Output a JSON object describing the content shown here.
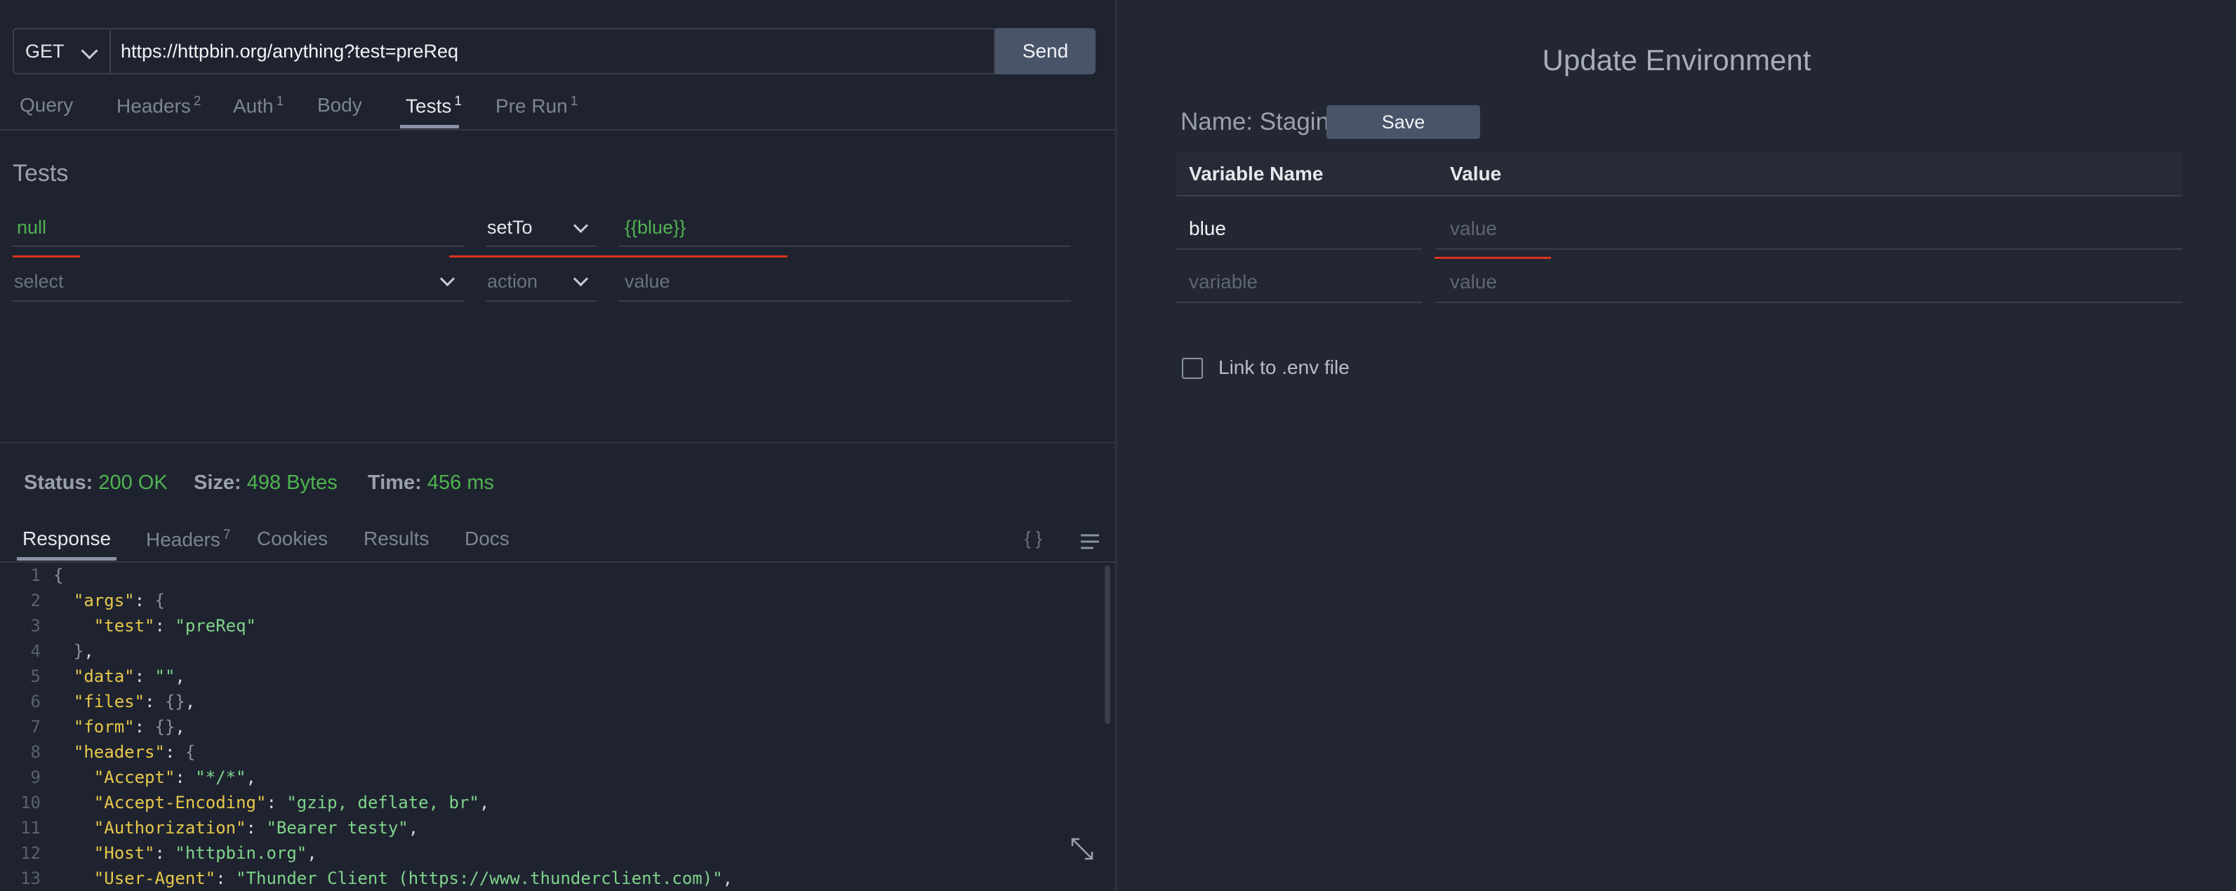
{
  "request": {
    "method": "GET",
    "url": "https://httpbin.org/anything?test=preReq",
    "send_label": "Send"
  },
  "request_tabs": [
    {
      "label": "Query",
      "badge": ""
    },
    {
      "label": "Headers",
      "badge": "2"
    },
    {
      "label": "Auth",
      "badge": "1"
    },
    {
      "label": "Body",
      "badge": ""
    },
    {
      "label": "Tests",
      "badge": "1"
    },
    {
      "label": "Pre Run",
      "badge": "1"
    }
  ],
  "active_request_tab": "Tests",
  "tests": {
    "title": "Tests",
    "rows": [
      {
        "source": "null",
        "action": "setTo",
        "value": "{{blue}}"
      },
      {
        "source_placeholder": "select",
        "action_placeholder": "action",
        "value_placeholder": "value"
      }
    ]
  },
  "status": {
    "status_label": "Status:",
    "status_value": "200 OK",
    "size_label": "Size:",
    "size_value": "498 Bytes",
    "time_label": "Time:",
    "time_value": "456 ms"
  },
  "response_tabs": [
    {
      "label": "Response",
      "badge": ""
    },
    {
      "label": "Headers",
      "badge": "7"
    },
    {
      "label": "Cookies",
      "badge": ""
    },
    {
      "label": "Results",
      "badge": ""
    },
    {
      "label": "Docs",
      "badge": ""
    }
  ],
  "response_icons": {
    "format": "{ }",
    "menu": "hamburger-icon"
  },
  "code_lines": [
    {
      "n": "1",
      "html": "<span class=\"pm\">{</span>"
    },
    {
      "n": "2",
      "html": "  <span class=\"k\">\"args\"</span><span class=\"p\">: </span><span class=\"pm\">{</span>"
    },
    {
      "n": "3",
      "html": "    <span class=\"k\">\"test\"</span><span class=\"p\">: </span><span class=\"s\">\"preReq\"</span>"
    },
    {
      "n": "4",
      "html": "  <span class=\"pm\">}</span><span class=\"p\">,</span>"
    },
    {
      "n": "5",
      "html": "  <span class=\"k\">\"data\"</span><span class=\"p\">: </span><span class=\"s\">\"\"</span><span class=\"p\">,</span>"
    },
    {
      "n": "6",
      "html": "  <span class=\"k\">\"files\"</span><span class=\"p\">: </span><span class=\"pm\">{}</span><span class=\"p\">,</span>"
    },
    {
      "n": "7",
      "html": "  <span class=\"k\">\"form\"</span><span class=\"p\">: </span><span class=\"pm\">{}</span><span class=\"p\">,</span>"
    },
    {
      "n": "8",
      "html": "  <span class=\"k\">\"headers\"</span><span class=\"p\">: </span><span class=\"pm\">{</span>"
    },
    {
      "n": "9",
      "html": "    <span class=\"k\">\"Accept\"</span><span class=\"p\">: </span><span class=\"s\">\"*/*\"</span><span class=\"p\">,</span>"
    },
    {
      "n": "10",
      "html": "    <span class=\"k\">\"Accept-Encoding\"</span><span class=\"p\">: </span><span class=\"s\">\"gzip, deflate, br\"</span><span class=\"p\">,</span>"
    },
    {
      "n": "11",
      "html": "    <span class=\"k\">\"Authorization\"</span><span class=\"p\">: </span><span class=\"s\">\"Bearer testy\"</span><span class=\"p\">,</span>"
    },
    {
      "n": "12",
      "html": "    <span class=\"k\">\"Host\"</span><span class=\"p\">: </span><span class=\"s\">\"httpbin.org\"</span><span class=\"p\">,</span>"
    },
    {
      "n": "13",
      "html": "    <span class=\"k\">\"User-Agent\"</span><span class=\"p\">: </span><span class=\"s\">\"Thunder Client (https://www.thunderclient.com)\"</span><span class=\"p\">,</span>"
    }
  ],
  "environment": {
    "title": "Update Environment",
    "name_label": "Name: Staging",
    "save_label": "Save",
    "col_name": "Variable Name",
    "col_value": "Value",
    "rows": [
      {
        "name": "blue",
        "value_placeholder": "value"
      },
      {
        "name_placeholder": "variable",
        "value_placeholder": "value"
      }
    ],
    "link_env_label": "Link to .env file"
  },
  "colors": {
    "accent_green": "#4fb34f",
    "error_red": "#d9341f",
    "button": "#4a5468"
  }
}
